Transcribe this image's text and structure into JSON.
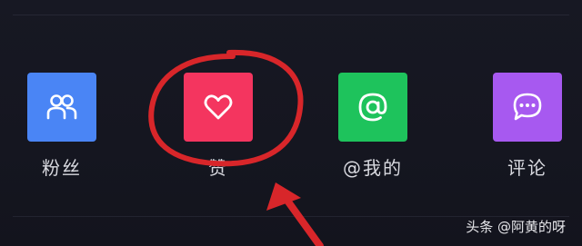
{
  "actions": [
    {
      "key": "fans",
      "label": "粉丝",
      "icon": "people-icon",
      "color": "#4a85f5"
    },
    {
      "key": "likes",
      "label": "赞",
      "icon": "heart-icon",
      "color": "#f4355f"
    },
    {
      "key": "mentions",
      "label": "@我的",
      "icon": "at-sign-icon",
      "color": "#1ec35c"
    },
    {
      "key": "comments",
      "label": "评论",
      "icon": "chat-bubble-icon",
      "color": "#a759f0"
    }
  ],
  "annotation": {
    "circle_color": "#d8262a",
    "arrow_color": "#d8262a"
  },
  "watermark": {
    "text": "头条 @阿黄的呀"
  }
}
